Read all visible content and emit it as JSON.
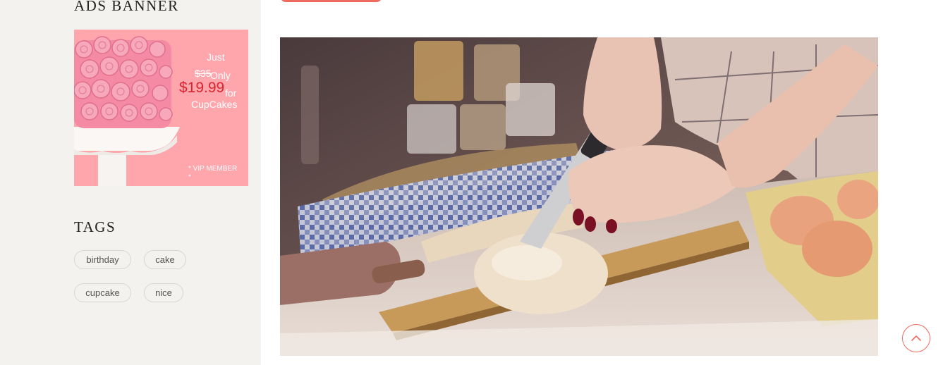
{
  "sidebar": {
    "ads_title": "ADS BANNER",
    "ad": {
      "just": "Just",
      "old_price": "$35",
      "only": "Only",
      "price": "$19.99",
      "for": "for",
      "product": "CupCakes",
      "vip": "* VIP MEMBER *"
    },
    "tags_title": "TAGS",
    "tags": [
      "birthday",
      "cake",
      "cupcake",
      "nice"
    ]
  },
  "colors": {
    "accent": "#ef6b5f",
    "sidebar_bg": "#f4f2ef",
    "ad_bg": "#ffa6ad",
    "price": "#d9252f"
  },
  "icons": {
    "back_to_top": "chevron-up-icon"
  }
}
